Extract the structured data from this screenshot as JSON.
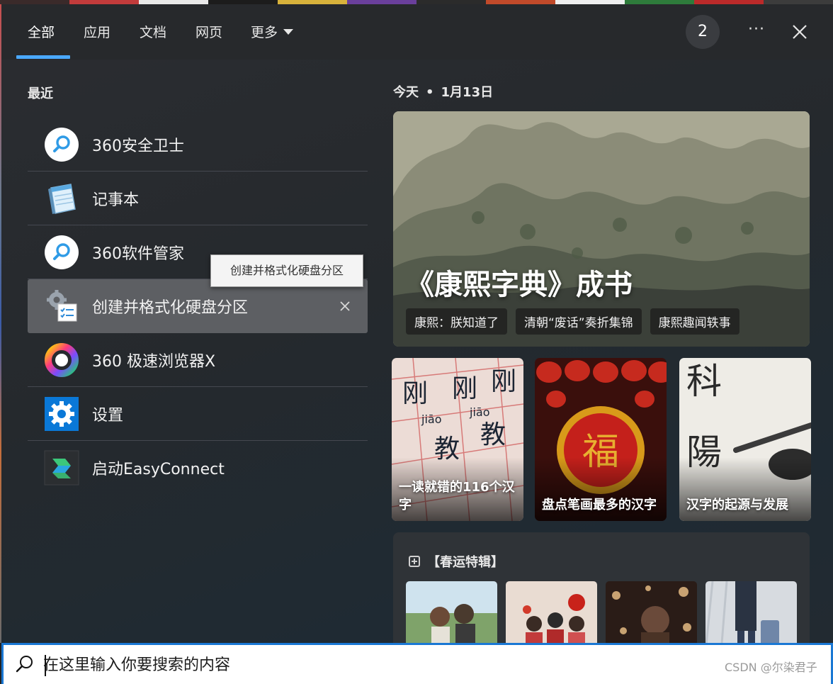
{
  "tabs": [
    {
      "label": "全部"
    },
    {
      "label": "应用"
    },
    {
      "label": "文档"
    },
    {
      "label": "网页"
    },
    {
      "label": "更多"
    }
  ],
  "header": {
    "badge": "2",
    "more": "···"
  },
  "recent": {
    "title": "最近",
    "items": [
      {
        "label": "360安全卫士",
        "icon": "magnifier-badge-icon"
      },
      {
        "label": "记事本",
        "icon": "notepad-icon"
      },
      {
        "label": "360软件管家",
        "icon": "magnifier-badge-icon"
      },
      {
        "label": "创建并格式化硬盘分区",
        "icon": "disk-management-icon"
      },
      {
        "label": "360 极速浏览器X",
        "icon": "browser-ring-icon"
      },
      {
        "label": "设置",
        "icon": "gear-icon"
      },
      {
        "label": "启动EasyConnect",
        "icon": "easyconnect-icon"
      }
    ],
    "tooltip": "创建并格式化硬盘分区"
  },
  "today": {
    "label": "今天",
    "separator": "•",
    "date": "1月13日"
  },
  "hero": {
    "title": "《康熙字典》成书",
    "chips": [
      "康熙：朕知道了",
      "清朝“废话”奏折集锦",
      "康熙趣闻轶事"
    ]
  },
  "cards": [
    {
      "caption": "一读就错的116个汉字"
    },
    {
      "caption": "盘点笔画最多的汉字"
    },
    {
      "caption": "汉字的起源与发展"
    }
  ],
  "feature": {
    "title": "【春运特辑】"
  },
  "search": {
    "placeholder": "在这里输入你要搜索的内容"
  },
  "watermark": "CSDN @尔染君子",
  "colors": {
    "accent": "#4aa8ff",
    "search_border": "#1a78d4",
    "selected_item": "#5d5f63"
  }
}
